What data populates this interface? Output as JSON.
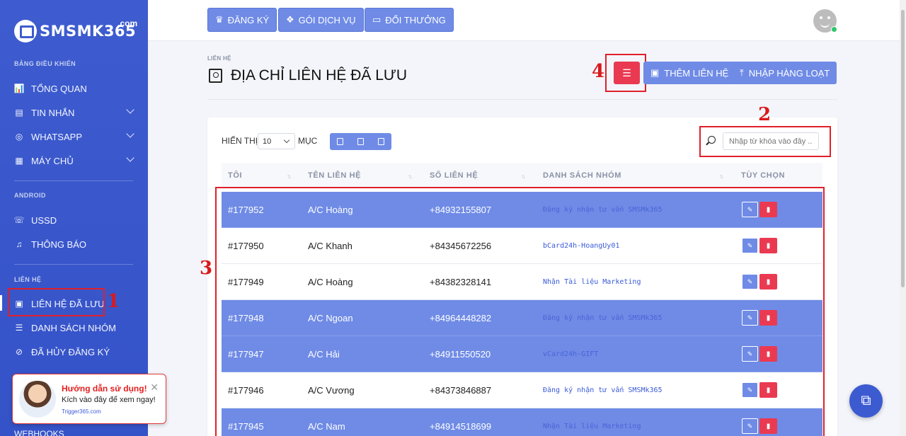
{
  "sidebar": {
    "logo": {
      "text": "SMSMK365",
      "suffix": ".com"
    },
    "sections": {
      "dashboard": "BẢNG ĐIỀU KHIỂN",
      "android": "ANDROID",
      "contacts": "LIÊN HỆ"
    },
    "items": [
      {
        "label": "TỔNG QUAN",
        "icon": "bar-chart-icon"
      },
      {
        "label": "TIN NHẮN",
        "icon": "message-icon"
      },
      {
        "label": "WHATSAPP",
        "icon": "whatsapp-icon"
      },
      {
        "label": "MÁY CHỦ",
        "icon": "server-icon"
      },
      {
        "label": "USSD",
        "icon": "ussd-icon"
      },
      {
        "label": "THÔNG BÁO",
        "icon": "bell-icon"
      },
      {
        "label": "LIÊN HỆ ĐÃ LƯU",
        "icon": "contact-card-icon"
      },
      {
        "label": "DANH SÁCH NHÓM",
        "icon": "list-icon"
      },
      {
        "label": "ĐÃ HỦY ĐĂNG KÝ",
        "icon": "unsubscribe-icon"
      }
    ],
    "webhooks": "WEBHOOKS"
  },
  "help_popup": {
    "title": "Hướng dẫn sử dụng!",
    "text": "Kích vào đây để xem ngay!",
    "link": "Trigger365.com"
  },
  "topbar": {
    "buttons": [
      "ĐĂNG KÝ",
      "GÓI DỊCH VỤ",
      "ĐỔI THƯỞNG"
    ]
  },
  "page": {
    "breadcrumb": "LIÊN HỆ",
    "title": "ĐỊA CHỈ LIÊN HỆ ĐÃ LƯU",
    "add_contact": "THÊM LIÊN HỆ",
    "bulk_import": "NHẬP HÀNG LOẠT"
  },
  "table_controls": {
    "show_label": "HIỂN THỊ",
    "page_size": "10",
    "entries_label": "MỤC",
    "search_placeholder": "Nhập từ khóa vào đây ..."
  },
  "table": {
    "headers": [
      "TÔI",
      "TÊN LIÊN HỆ",
      "SỐ LIÊN HỆ",
      "DANH SÁCH NHÓM",
      "TÙY CHỌN"
    ],
    "rows": [
      {
        "id": "#177952",
        "name": "A/C Hoàng",
        "phone": "+84932155807",
        "group": "Đăng ký nhận tư vấn SMSMk365",
        "highlight": true
      },
      {
        "id": "#177950",
        "name": "A/C Khanh",
        "phone": "+84345672256",
        "group": "bCard24h-HoangUy01",
        "highlight": false
      },
      {
        "id": "#177949",
        "name": "A/C Hoàng",
        "phone": "+84382328141",
        "group": "Nhận Tài liệu Marketing",
        "highlight": false
      },
      {
        "id": "#177948",
        "name": "A/C Ngoan",
        "phone": "+84964448282",
        "group": "Đăng ký nhận tư vấn SMSMk365",
        "highlight": true
      },
      {
        "id": "#177947",
        "name": "A/C Hải",
        "phone": "+84911550520",
        "group": "vCard24h-GIFT",
        "highlight": true
      },
      {
        "id": "#177946",
        "name": "A/C Vương",
        "phone": "+84373846887",
        "group": "Đăng ký nhận tư vấn SMSMk365",
        "highlight": false
      },
      {
        "id": "#177945",
        "name": "A/C Nam",
        "phone": "+84914518699",
        "group": "Nhận Tài liệu Marketing",
        "highlight": true
      }
    ]
  },
  "annotations": [
    "1",
    "2",
    "3",
    "4"
  ],
  "colors": {
    "sidebar": "#3e5ccf",
    "accent": "#6f8be6",
    "danger": "#ea3a52",
    "annotation": "#e0202a"
  }
}
